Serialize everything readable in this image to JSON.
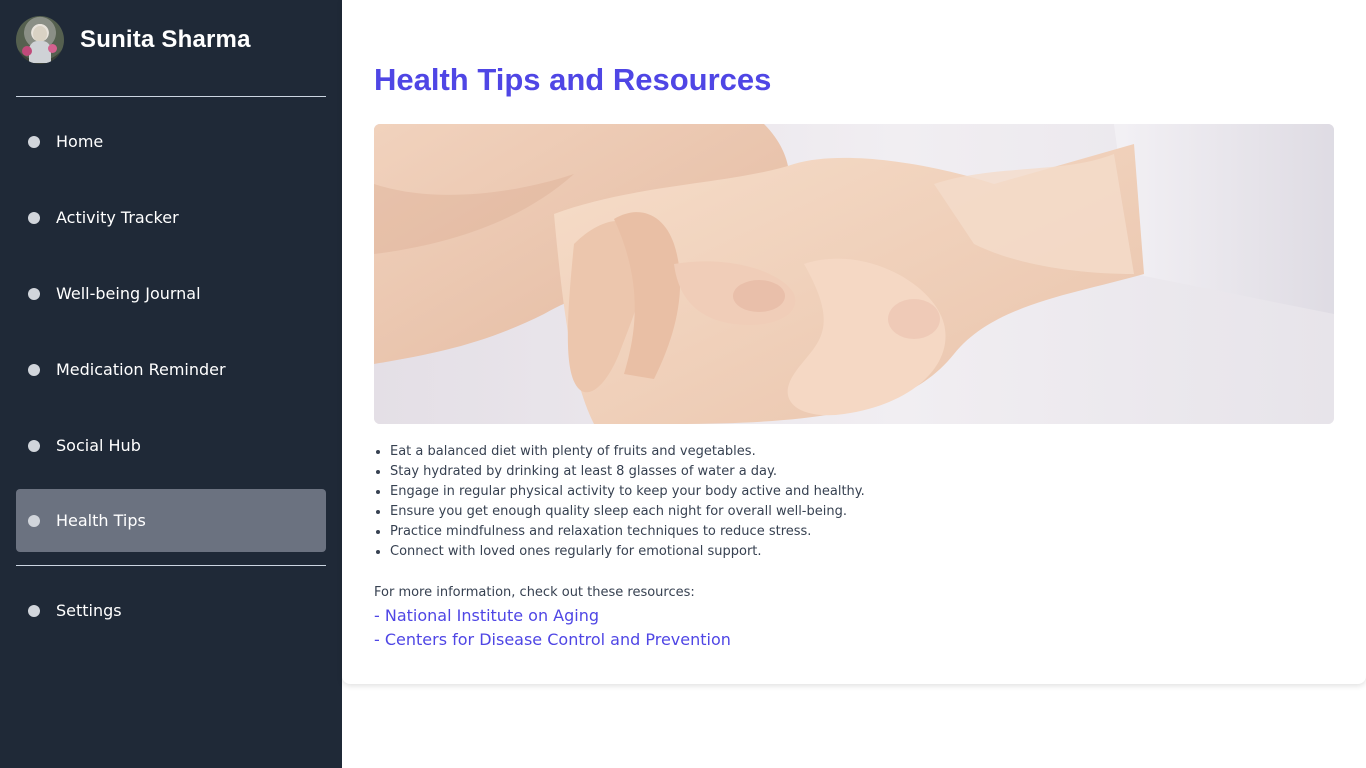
{
  "profile": {
    "name": "Sunita Sharma"
  },
  "sidebar": {
    "items": [
      {
        "label": "Home",
        "active": false
      },
      {
        "label": "Activity Tracker",
        "active": false
      },
      {
        "label": "Well-being Journal",
        "active": false
      },
      {
        "label": "Medication Reminder",
        "active": false
      },
      {
        "label": "Social Hub",
        "active": false
      },
      {
        "label": "Health Tips",
        "active": true
      },
      {
        "label": "Settings",
        "active": false
      }
    ]
  },
  "main": {
    "title": "Health Tips and Resources",
    "tips": [
      "Eat a balanced diet with plenty of fruits and vegetables.",
      "Stay hydrated by drinking at least 8 glasses of water a day.",
      "Engage in regular physical activity to keep your body active and healthy.",
      "Ensure you get enough quality sleep each night for overall well-being.",
      "Practice mindfulness and relaxation techniques to reduce stress.",
      "Connect with loved ones regularly for emotional support."
    ],
    "resources_intro": "For more information, check out these resources:",
    "resources": [
      "- National Institute on Aging",
      "- Centers for Disease Control and Prevention"
    ]
  },
  "colors": {
    "sidebar_bg": "#1f2937",
    "active_item_bg": "#6b7280",
    "accent": "#4f46e5",
    "text": "#374151"
  },
  "icons": {
    "nav_bullet": "circle-icon"
  }
}
